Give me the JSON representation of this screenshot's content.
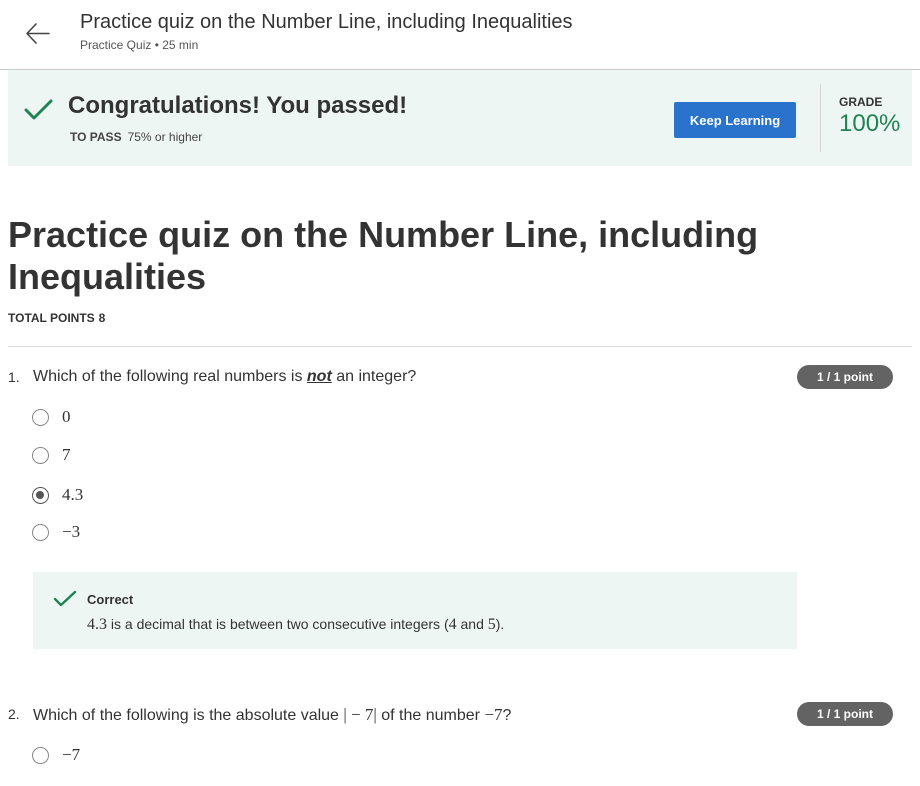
{
  "header": {
    "title": "Practice quiz on the Number Line, including Inequalities",
    "subtitle": "Practice Quiz • 25 min",
    "back_icon": "arrow-left-icon"
  },
  "result_banner": {
    "title": "Congratulations! You passed!",
    "to_pass_label": "TO PASS",
    "to_pass_value": "75% or higher",
    "keep_learning_label": "Keep Learning",
    "grade_label": "GRADE",
    "grade_value": "100%",
    "accent_color": "#1f8354",
    "button_color": "#2a73cc"
  },
  "quiz": {
    "title": "Practice quiz on the Number Line, including Inequalities",
    "total_points_label": "TOTAL POINTS",
    "total_points_value": "8"
  },
  "questions": [
    {
      "number": "1.",
      "text_before": "Which of the following real numbers is ",
      "text_emphasis": "not",
      "text_after": " an integer?",
      "points": "1 / 1 point",
      "options": [
        {
          "label": "0",
          "selected": false
        },
        {
          "label": "7",
          "selected": false
        },
        {
          "label": "4.3",
          "selected": true
        },
        {
          "label": "−3",
          "selected": false
        }
      ],
      "feedback": {
        "status": "Correct",
        "value": "4.3",
        "text_mid": " is a decimal that is between two consecutive integers (",
        "int_a": "4",
        "text_and": " and ",
        "int_b": "5",
        "text_end": ")."
      }
    },
    {
      "number": "2.",
      "text_before": "Which of the following is the absolute value ",
      "text_math_1": "| − 7|",
      "text_mid": " of the number ",
      "text_math_2": "−7",
      "text_after": "?",
      "points": "1 / 1 point",
      "options": [
        {
          "label": "−7",
          "selected": false
        }
      ]
    }
  ]
}
